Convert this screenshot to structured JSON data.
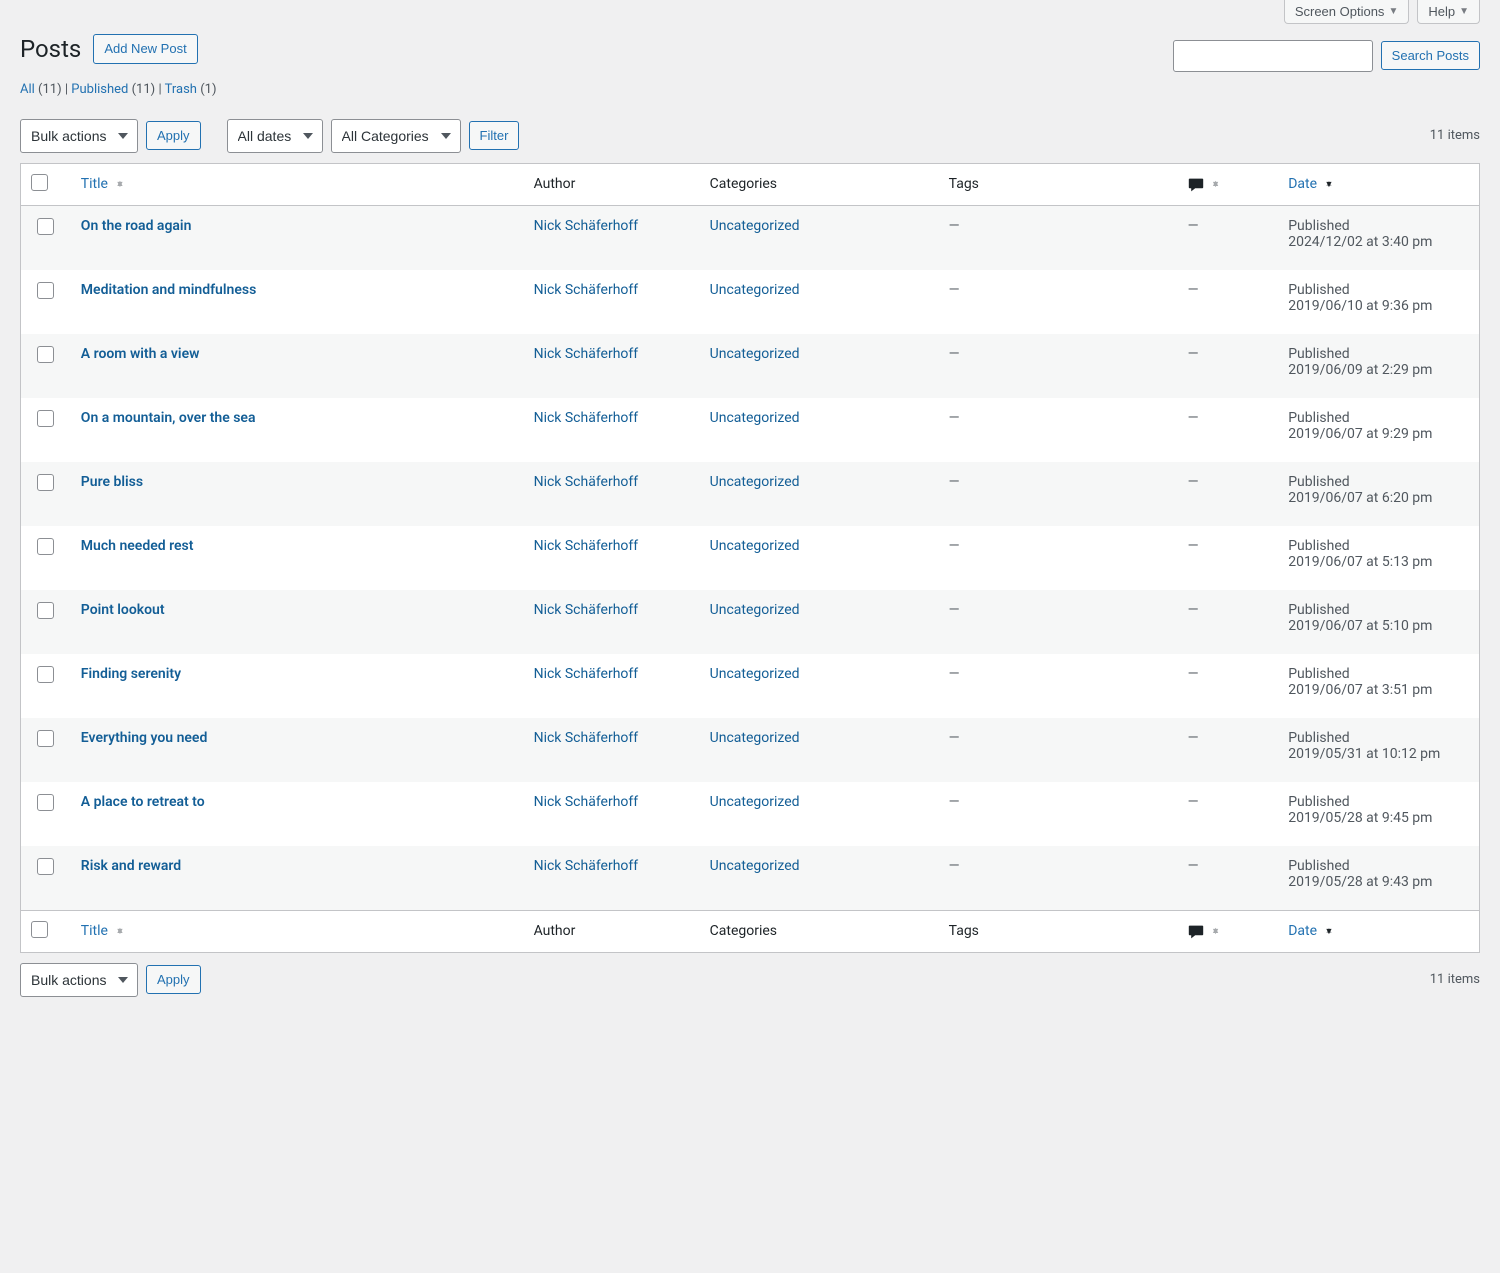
{
  "header": {
    "screen_options": "Screen Options",
    "help": "Help"
  },
  "page": {
    "title": "Posts",
    "add_new": "Add New Post",
    "search_button": "Search Posts"
  },
  "filters": {
    "all_label": "All",
    "all_count": "(11)",
    "published_label": "Published",
    "published_count": "(11)",
    "trash_label": "Trash",
    "trash_count": "(1)"
  },
  "controls": {
    "bulk_actions": "Bulk actions",
    "apply": "Apply",
    "all_dates": "All dates",
    "all_categories": "All Categories",
    "filter": "Filter",
    "items_count": "11 items"
  },
  "columns": {
    "title": "Title",
    "author": "Author",
    "categories": "Categories",
    "tags": "Tags",
    "date": "Date"
  },
  "posts": [
    {
      "title": "On the road again",
      "author": "Nick Schäferhoff",
      "category": "Uncategorized",
      "tags": "—",
      "comments": "—",
      "status": "Published",
      "date": "2024/12/02 at 3:40 pm"
    },
    {
      "title": "Meditation and mindfulness",
      "author": "Nick Schäferhoff",
      "category": "Uncategorized",
      "tags": "—",
      "comments": "—",
      "status": "Published",
      "date": "2019/06/10 at 9:36 pm"
    },
    {
      "title": "A room with a view",
      "author": "Nick Schäferhoff",
      "category": "Uncategorized",
      "tags": "—",
      "comments": "—",
      "status": "Published",
      "date": "2019/06/09 at 2:29 pm"
    },
    {
      "title": "On a mountain, over the sea",
      "author": "Nick Schäferhoff",
      "category": "Uncategorized",
      "tags": "—",
      "comments": "—",
      "status": "Published",
      "date": "2019/06/07 at 9:29 pm"
    },
    {
      "title": "Pure bliss",
      "author": "Nick Schäferhoff",
      "category": "Uncategorized",
      "tags": "—",
      "comments": "—",
      "status": "Published",
      "date": "2019/06/07 at 6:20 pm"
    },
    {
      "title": "Much needed rest",
      "author": "Nick Schäferhoff",
      "category": "Uncategorized",
      "tags": "—",
      "comments": "—",
      "status": "Published",
      "date": "2019/06/07 at 5:13 pm"
    },
    {
      "title": "Point lookout",
      "author": "Nick Schäferhoff",
      "category": "Uncategorized",
      "tags": "—",
      "comments": "—",
      "status": "Published",
      "date": "2019/06/07 at 5:10 pm"
    },
    {
      "title": "Finding serenity",
      "author": "Nick Schäferhoff",
      "category": "Uncategorized",
      "tags": "—",
      "comments": "—",
      "status": "Published",
      "date": "2019/06/07 at 3:51 pm"
    },
    {
      "title": "Everything you need",
      "author": "Nick Schäferhoff",
      "category": "Uncategorized",
      "tags": "—",
      "comments": "—",
      "status": "Published",
      "date": "2019/05/31 at 10:12 pm"
    },
    {
      "title": "A place to retreat to",
      "author": "Nick Schäferhoff",
      "category": "Uncategorized",
      "tags": "—",
      "comments": "—",
      "status": "Published",
      "date": "2019/05/28 at 9:45 pm"
    },
    {
      "title": "Risk and reward",
      "author": "Nick Schäferhoff",
      "category": "Uncategorized",
      "tags": "—",
      "comments": "—",
      "status": "Published",
      "date": "2019/05/28 at 9:43 pm"
    }
  ]
}
